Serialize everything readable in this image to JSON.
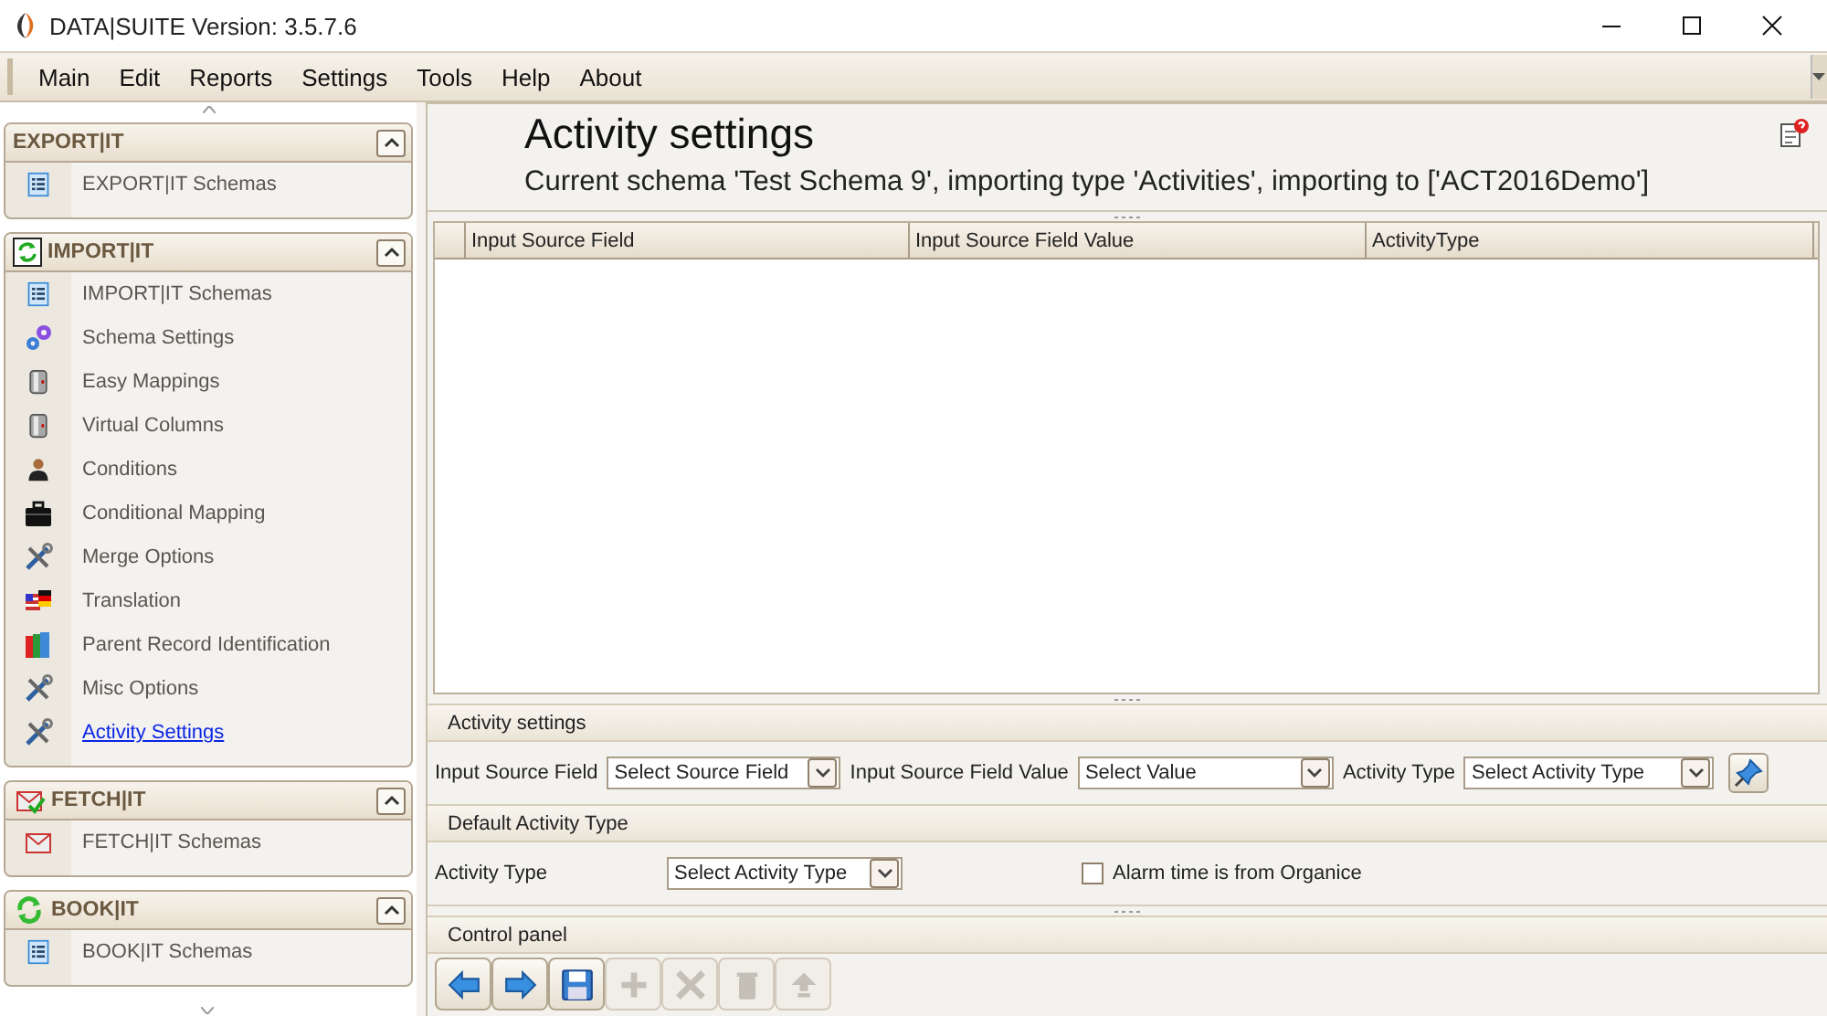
{
  "window": {
    "title": "DATA|SUITE Version: 3.5.7.6"
  },
  "menu": [
    "Main",
    "Edit",
    "Reports",
    "Settings",
    "Tools",
    "Help",
    "About"
  ],
  "sidebar": {
    "groups": [
      {
        "title": "EXPORT|IT",
        "expanded": true,
        "items": [
          {
            "label": "EXPORT|IT Schemas",
            "selected": false
          }
        ]
      },
      {
        "title": "IMPORT|IT",
        "expanded": true,
        "items": [
          {
            "label": "IMPORT|IT Schemas",
            "selected": false
          },
          {
            "label": "Schema Settings",
            "selected": false
          },
          {
            "label": "Easy Mappings",
            "selected": false
          },
          {
            "label": "Virtual Columns",
            "selected": false
          },
          {
            "label": "Conditions",
            "selected": false
          },
          {
            "label": "Conditional Mapping",
            "selected": false
          },
          {
            "label": "Merge Options",
            "selected": false
          },
          {
            "label": "Translation",
            "selected": false
          },
          {
            "label": "Parent Record Identification",
            "selected": false
          },
          {
            "label": "Misc Options",
            "selected": false
          },
          {
            "label": "Activity Settings",
            "selected": true
          }
        ]
      },
      {
        "title": "FETCH|IT",
        "expanded": true,
        "items": [
          {
            "label": "FETCH|IT Schemas",
            "selected": false
          }
        ]
      },
      {
        "title": "BOOK|IT",
        "expanded": true,
        "items": [
          {
            "label": "BOOK|IT Schemas",
            "selected": false
          }
        ]
      }
    ]
  },
  "main": {
    "title": "Activity settings",
    "subtitle": "Current schema 'Test Schema 9', importing type 'Activities', importing to ['ACT2016Demo']",
    "table": {
      "columns": [
        "Input Source Field",
        "Input Source Field Value",
        "ActivityType"
      ]
    },
    "activity_settings": {
      "title": "Activity settings",
      "fields": [
        {
          "label": "Input Source Field",
          "value": "Select Source Field"
        },
        {
          "label": "Input Source Field Value",
          "value": "Select Value"
        },
        {
          "label": "Activity Type",
          "value": "Select Activity Type"
        }
      ]
    },
    "default_activity_type": {
      "title": "Default Activity Type",
      "label": "Activity Type",
      "value": "Select Activity Type",
      "checkbox": {
        "label": "Alarm time is from Organice",
        "checked": false
      }
    },
    "control_panel": {
      "title": "Control panel",
      "buttons": [
        {
          "disabled": false
        },
        {
          "disabled": false
        },
        {
          "disabled": false
        },
        {
          "disabled": true
        },
        {
          "disabled": true
        },
        {
          "disabled": true
        },
        {
          "disabled": true
        }
      ]
    }
  }
}
